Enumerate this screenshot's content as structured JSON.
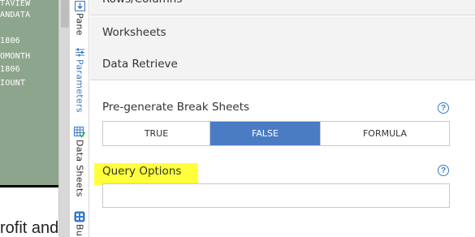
{
  "sheet": {
    "cells": [
      "TAVIEW",
      "ANDATA",
      "",
      "1806",
      "OMONTH",
      "1806",
      "IOUNT"
    ],
    "bottom_text": "rofit and"
  },
  "side_tabs": [
    {
      "label": "Pane",
      "icon": "download-pane-icon"
    },
    {
      "label": "Parameters",
      "icon": "sliders-icon"
    },
    {
      "label": "Data Sheets",
      "icon": "grid-check-icon"
    },
    {
      "label": "Bu",
      "icon": "blocks-icon"
    }
  ],
  "sections": {
    "rows_columns": "Rows/Columns",
    "worksheets": "Worksheets",
    "data_retrieve": "Data Retrieve"
  },
  "break_sheets": {
    "label": "Pre-generate Break Sheets",
    "options": [
      "TRUE",
      "FALSE",
      "FORMULA"
    ],
    "selected": "FALSE"
  },
  "query_options": {
    "label": "Query Options",
    "value": "",
    "highlight_color": "#ffff3c"
  },
  "help_symbol": "?",
  "colors": {
    "accent": "#4a7cc4",
    "active_tab_text": "#3b78c3",
    "sheet_background": "#8da58d"
  }
}
